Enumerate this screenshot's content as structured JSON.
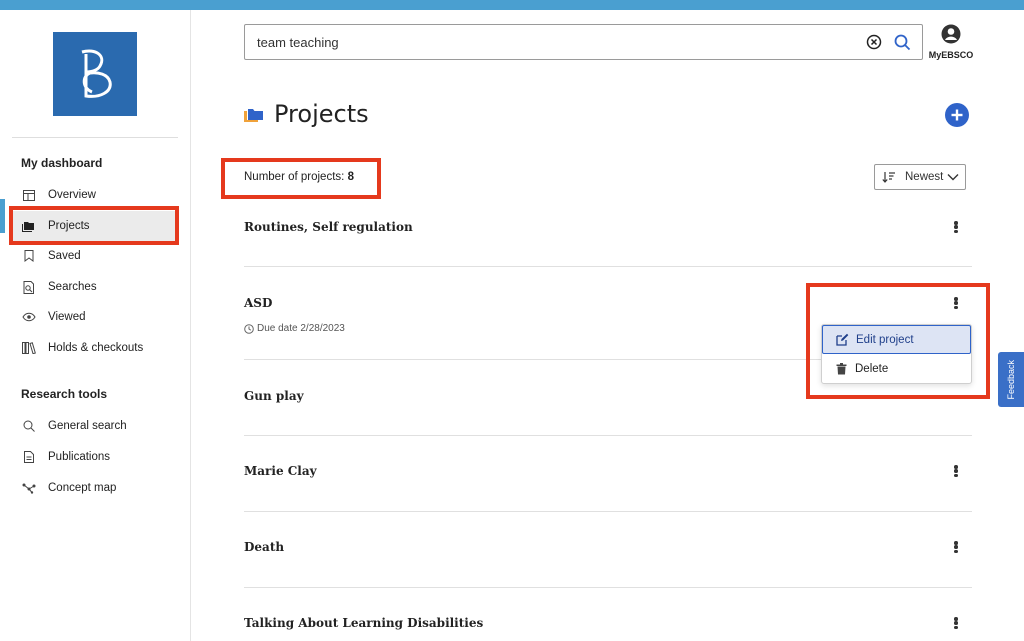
{
  "search": {
    "query": "team teaching"
  },
  "account": {
    "label": "MyEBSCO"
  },
  "sidebar": {
    "dashboard_heading": "My dashboard",
    "dashboard_items": [
      {
        "label": "Overview",
        "icon": "overview-icon"
      },
      {
        "label": "Projects",
        "icon": "folder-icon",
        "active": true
      },
      {
        "label": "Saved",
        "icon": "bookmark-icon"
      },
      {
        "label": "Searches",
        "icon": "search-history-icon"
      },
      {
        "label": "Viewed",
        "icon": "eye-icon"
      },
      {
        "label": "Holds & checkouts",
        "icon": "books-icon"
      }
    ],
    "tools_heading": "Research tools",
    "tools_items": [
      {
        "label": "General search",
        "icon": "search-icon"
      },
      {
        "label": "Publications",
        "icon": "document-icon"
      },
      {
        "label": "Concept map",
        "icon": "concept-map-icon"
      }
    ]
  },
  "page": {
    "title": "Projects",
    "count_label": "Number of projects:",
    "count_value": "8",
    "sort_label": "Newest"
  },
  "projects": [
    {
      "name": "Routines, Self regulation"
    },
    {
      "name": "ASD",
      "due": "Due date 2/28/2023"
    },
    {
      "name": "Gun play"
    },
    {
      "name": "Marie Clay"
    },
    {
      "name": "Death"
    },
    {
      "name": "Talking About Learning Disabilities"
    }
  ],
  "menu": {
    "edit_label": "Edit project",
    "delete_label": "Delete"
  },
  "feedback": {
    "label": "Feedback"
  },
  "colors": {
    "accent": "#2f63c9",
    "highlight": "#e5391d",
    "topbar": "#4a9fd0"
  }
}
